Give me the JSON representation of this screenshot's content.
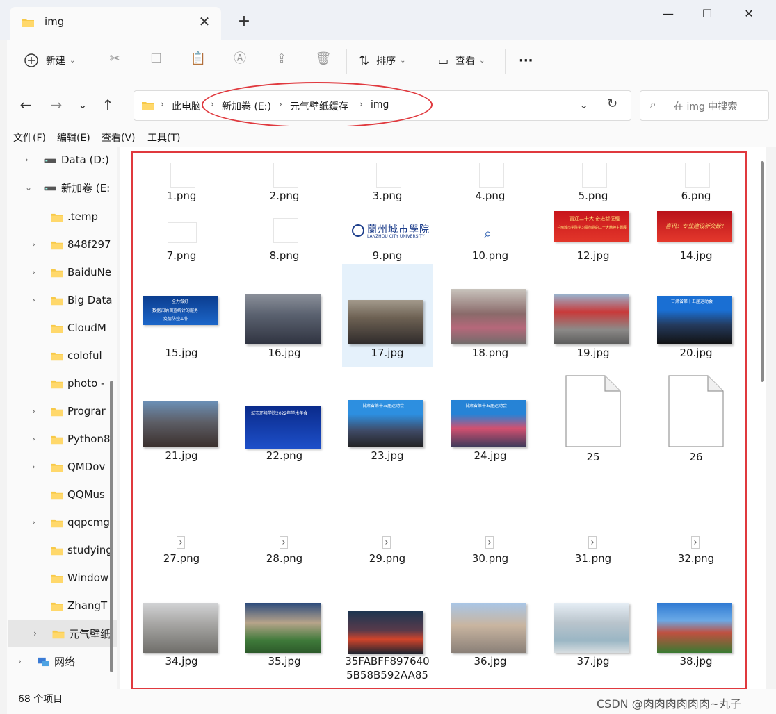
{
  "window": {
    "tab_title": "img",
    "close_tab": "✕",
    "new_tab": "+",
    "min": "—",
    "max": "☐",
    "close": "✕"
  },
  "toolbar": {
    "new_label": "新建",
    "sort_label": "排序",
    "view_label": "查看",
    "more": "···"
  },
  "nav": {
    "back": "←",
    "forward": "→",
    "recent": "⌄",
    "up": "↑",
    "breadcrumbs": [
      "此电脑",
      "新加卷 (E:)",
      "元气壁纸缓存",
      "img"
    ],
    "search_placeholder": "在 img 中搜索"
  },
  "menu": [
    "文件(F)",
    "编辑(E)",
    "查看(V)",
    "工具(T)"
  ],
  "sidebar": [
    {
      "label": "Data (D:)",
      "arrow": "›",
      "kind": "drive"
    },
    {
      "label": "新加卷 (E:",
      "arrow": "⌄",
      "kind": "drive"
    },
    {
      "label": ".temp",
      "arrow": "",
      "kind": "folder"
    },
    {
      "label": "848f297",
      "arrow": "›",
      "kind": "folder"
    },
    {
      "label": "BaiduNe",
      "arrow": "›",
      "kind": "folder"
    },
    {
      "label": "Big Data",
      "arrow": "›",
      "kind": "folder"
    },
    {
      "label": "CloudM",
      "arrow": "",
      "kind": "folder"
    },
    {
      "label": "coloful",
      "arrow": "",
      "kind": "folder"
    },
    {
      "label": "photo -",
      "arrow": "",
      "kind": "folder"
    },
    {
      "label": "Prograr",
      "arrow": "›",
      "kind": "folder"
    },
    {
      "label": "Python8",
      "arrow": "›",
      "kind": "folder"
    },
    {
      "label": "QMDov",
      "arrow": "›",
      "kind": "folder"
    },
    {
      "label": "QQMus",
      "arrow": "",
      "kind": "folder"
    },
    {
      "label": "qqpcmg",
      "arrow": "›",
      "kind": "folder"
    },
    {
      "label": "studying",
      "arrow": "",
      "kind": "folder"
    },
    {
      "label": "Window",
      "arrow": "",
      "kind": "folder"
    },
    {
      "label": "ZhangT",
      "arrow": "",
      "kind": "folder"
    },
    {
      "label": "元气壁纸",
      "arrow": "›",
      "kind": "folder",
      "selected": true
    },
    {
      "label": "网络",
      "arrow": "›",
      "kind": "network"
    }
  ],
  "files": [
    {
      "name": "1.png",
      "type": "blank"
    },
    {
      "name": "2.png",
      "type": "blank"
    },
    {
      "name": "3.png",
      "type": "blank"
    },
    {
      "name": "4.png",
      "type": "blank"
    },
    {
      "name": "5.png",
      "type": "blank"
    },
    {
      "name": "6.png",
      "type": "blank"
    },
    {
      "name": "7.png",
      "type": "blank"
    },
    {
      "name": "8.png",
      "type": "blank"
    },
    {
      "name": "9.png",
      "type": "logo"
    },
    {
      "name": "10.png",
      "type": "search"
    },
    {
      "name": "12.jpg",
      "type": "banner-red"
    },
    {
      "name": "14.jpg",
      "type": "banner-red2"
    },
    {
      "name": "15.jpg",
      "type": "blue-slide"
    },
    {
      "name": "16.jpg",
      "type": "meeting"
    },
    {
      "name": "17.jpg",
      "type": "meeting2",
      "selected": true
    },
    {
      "name": "18.png",
      "type": "outdoor"
    },
    {
      "name": "19.jpg",
      "type": "arch"
    },
    {
      "name": "20.jpg",
      "type": "team"
    },
    {
      "name": "21.jpg",
      "type": "meeting3"
    },
    {
      "name": "22.png",
      "type": "blue-slide2"
    },
    {
      "name": "23.jpg",
      "type": "team2"
    },
    {
      "name": "24.jpg",
      "type": "team3"
    },
    {
      "name": "25",
      "type": "doc"
    },
    {
      "name": "26",
      "type": "doc"
    },
    {
      "name": "27.png",
      "type": "arrow"
    },
    {
      "name": "28.png",
      "type": "arrow"
    },
    {
      "name": "29.png",
      "type": "arrow"
    },
    {
      "name": "30.png",
      "type": "arrow"
    },
    {
      "name": "31.png",
      "type": "arrow"
    },
    {
      "name": "32.png",
      "type": "arrow"
    },
    {
      "name": "34.jpg",
      "type": "building"
    },
    {
      "name": "35.jpg",
      "type": "campus"
    },
    {
      "name": "35FABFF897640 5B58B592AA85",
      "type": "dark"
    },
    {
      "name": "36.jpg",
      "type": "campus2"
    },
    {
      "name": "37.jpg",
      "type": "campus3"
    },
    {
      "name": "38.jpg",
      "type": "campus4"
    }
  ],
  "thumb_text": {
    "logo_cn": "蘭州城市學院",
    "logo_en": "LANZHOU CITY UNIVERSITY",
    "banner12_line1": "喜迎二十大 奋进新征程",
    "banner12_line2": "兰州城市学院学习贯彻党的二十大精神主题展",
    "banner14": "喜讯！专业建设新突破！",
    "slide15_l1": "全力做好",
    "slide15_l2": "数据归纳调查统计的服务",
    "slide15_l3": "疫情防控工作",
    "slide22_title": "城市环境学院2022年学术年会",
    "banner20": "甘肃省第十五届运动会",
    "banner23": "甘肃省第十五届运动会",
    "banner24": "甘肃省第十五届运动会"
  },
  "status": {
    "count": "68 个项目"
  },
  "watermark": "CSDN @肉肉肉肉肉肉~丸子"
}
